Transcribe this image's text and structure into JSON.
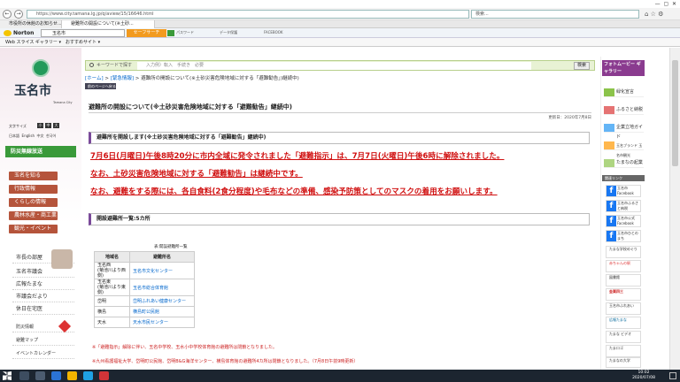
{
  "browser": {
    "url": "https://www.city.tamana.lg.jp/q/aview/15/16646.html",
    "search_placeholder": "検索...",
    "tabs": [
      "市役所の休館のお知らせ...",
      "避難所の開設について(※土砂..."
    ],
    "toolbar": {
      "norton": "Norton",
      "search_value": "玉名市",
      "safe_web": "セーフサーチ",
      "pwd": "パスワード",
      "data": "データ保護",
      "fb": "FACEBOOK"
    },
    "favorites": [
      "Web スライス ギャラリー ▾",
      "おすすめサイト ▾"
    ]
  },
  "site": {
    "logo": "玉名市",
    "logo_sub": "Tamana City",
    "search_placeholder": "キーワードで探す",
    "search_hint": "入力例）転入　手続き　必要",
    "search_btn": "検索",
    "text_size_label": "文字サイズ",
    "text_sizes": [
      "小",
      "中",
      "大"
    ],
    "languages": [
      "日本語",
      "English",
      "中文",
      "한국어"
    ],
    "disaster_label": "防災無線放送",
    "left_nav": [
      "玉名を知る",
      "行政情報",
      "くらしの情報",
      "農林水産・商工業",
      "観光・イベント"
    ],
    "left_nav2": [
      "市長の部屋",
      "玉名市議会",
      "広報たまな",
      "市議会だより",
      "休日在宅医",
      "防災情報",
      "避難マップ",
      "イベントカレンダー"
    ]
  },
  "breadcrumb": [
    "[ホーム]",
    ">",
    "[緊急情報]",
    ">",
    "避難所の開設について(※土砂災害危険地域に対する「避難勧告」)継続中)"
  ],
  "prev_page": "前のページへ戻る",
  "article": {
    "title": "避難所の開設について(※土砂災害危険地域に対する「避難勧告」継続中)",
    "updated": "更新日：2020年7月8日",
    "subtitle": "避難所を開設します(※土砂災害危険地域に対する「避難勧告」継続中)",
    "red_lines": [
      "7月6日(月曜日)午後8時20分に市内全域に発令されました「避難指示」は、7月7日(火曜日)午後6時に解除されました。",
      "なお、土砂災害危険地域に対する「避難勧告」は継続中です。",
      "なお、避難をする際には、各自食料(2食分程度)や毛布などの準備、感染予防策としてのマスクの着用をお願いします。"
    ],
    "list_title": "開設避難所一覧:5カ所",
    "table_caption": "表:開設避難所一覧",
    "table_headers": [
      "地域名",
      "避難所名"
    ],
    "table_rows": [
      [
        "玉名西\n(菊池川より西側)",
        "玉名市文化センター"
      ],
      [
        "玉名東\n(菊池川より東側)",
        "玉名市総合体育館"
      ],
      [
        "岱明",
        "岱明ふれあい健康センター"
      ],
      [
        "横島",
        "横島町公民館"
      ],
      [
        "天水",
        "天水市民センター"
      ]
    ],
    "notes": [
      "※「避難指示」解除に伴い、玉名中学校、玉水小中学校体育館の避難所は閉鎖となりました。",
      "※九州看護福祉大学、岱明町公民館、岱明B&G海洋センター、横島体育館の避難所4カ所は閉鎖となりました。（7月8日午前9時更新）"
    ]
  },
  "right": {
    "banner_top": "フォトムービー ギャラリー",
    "banners": [
      "緑化宣言",
      "ふるさと納税",
      "企業立地ガイド",
      "玉名ブランド 玉名市観光",
      "たまなの起業"
    ],
    "related_label": "関連リンク",
    "fb_items": [
      "玉名市 Facebook",
      "玉名市ふるさと納税",
      "玉名市公式 Facebook",
      "玉名市ひとのまち"
    ],
    "promos": [
      "たまな学校めぐり",
      "赤ちゃんの駅",
      "図書館",
      "金栗四三",
      "玉名市ふれあい",
      "広報たまな",
      "たまな ビデオ",
      "たまロゴ",
      "玉名市 観光",
      "たまなの大学"
    ]
  },
  "taskbar": {
    "time": "10:02",
    "date": "2020/07/08"
  }
}
